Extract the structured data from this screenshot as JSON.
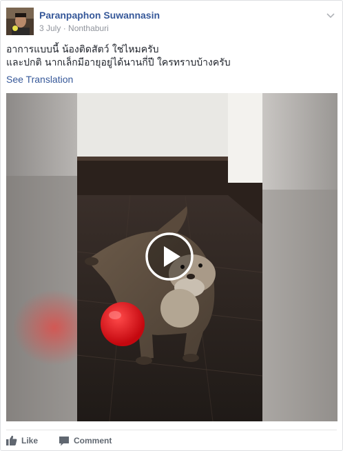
{
  "post": {
    "author": "Paranpaphon Suwannasin",
    "date": "3 July",
    "separator": "·",
    "location": "Nonthaburi",
    "text_line1": "อาการแบบนี้ น้องติดสัตว์ ใช่ไหมครับ",
    "text_line2": "และปกติ นากเล็กมีอายุอยู่ได้นานกี่ปี ใครทราบบ้างครับ",
    "see_translation": "See Translation"
  },
  "actions": {
    "like_label": "Like",
    "comment_label": "Comment"
  },
  "icons": {
    "menu": "chevron-down-icon",
    "play": "play-icon",
    "like": "thumbs-up-icon",
    "comment": "comment-icon"
  },
  "colors": {
    "link": "#365899",
    "meta": "#90949c",
    "action": "#606770",
    "ball": "#e8141c"
  }
}
